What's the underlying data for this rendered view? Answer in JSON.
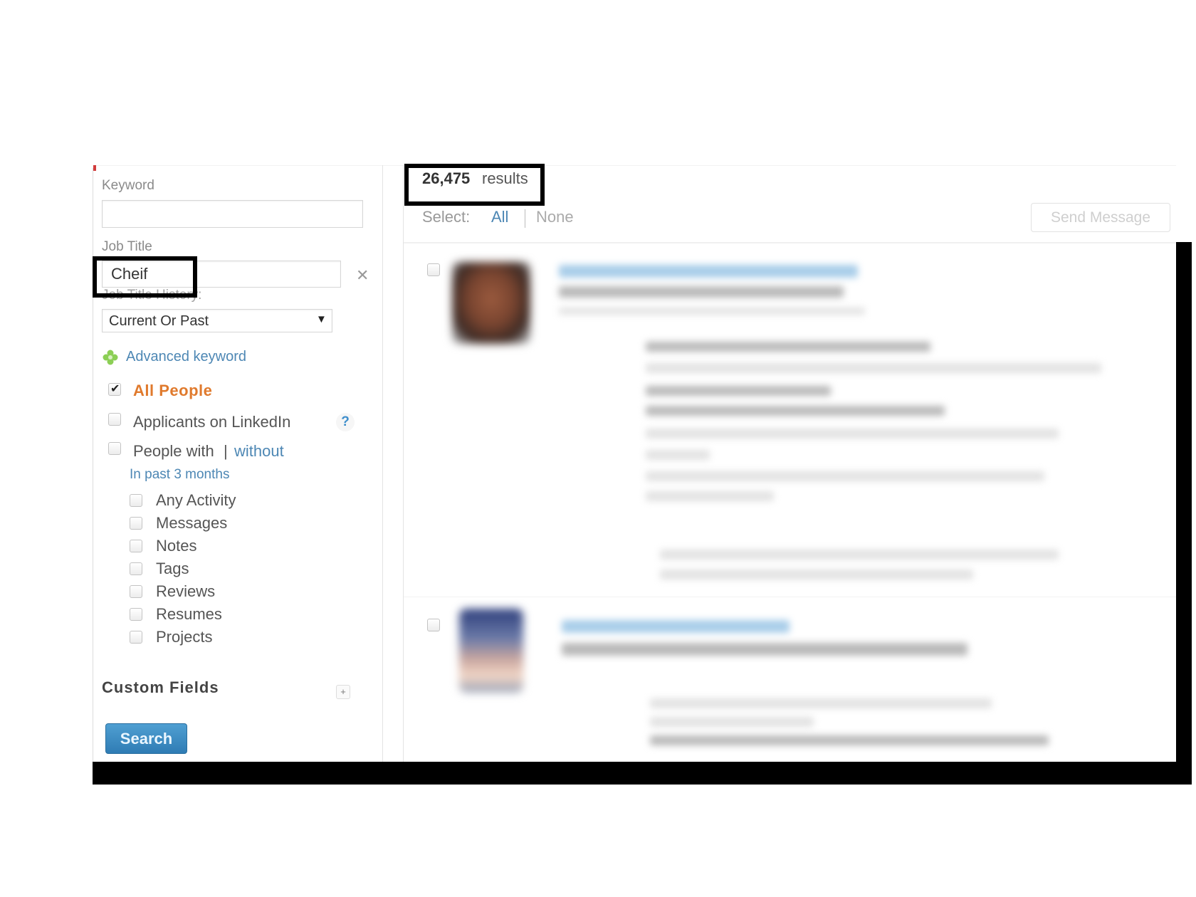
{
  "sidebar": {
    "keyword": {
      "label": "Keyword",
      "value": ""
    },
    "job_title": {
      "label": "Job Title",
      "value": "Cheif"
    },
    "job_title_history": {
      "label": "Job Title History:",
      "selected": "Current Or Past"
    },
    "advanced_keyword": "Advanced keyword",
    "filters": {
      "all_people": {
        "label": "All People",
        "checked": true
      },
      "applicants": {
        "label": "Applicants on LinkedIn",
        "checked": false,
        "help": "?"
      },
      "people_with": {
        "label_with": "People with",
        "separator": "|",
        "label_without": "without",
        "checked": false
      },
      "timeframe": "In past 3 months"
    },
    "activities": [
      {
        "label": "Any Activity",
        "checked": false
      },
      {
        "label": "Messages",
        "checked": false
      },
      {
        "label": "Notes",
        "checked": false
      },
      {
        "label": "Tags",
        "checked": false
      },
      {
        "label": "Reviews",
        "checked": false
      },
      {
        "label": "Resumes",
        "checked": false
      },
      {
        "label": "Projects",
        "checked": false
      }
    ],
    "custom_fields": {
      "title": "Custom Fields",
      "add_icon": "+"
    },
    "search_label": "Search",
    "clear_icon": "✕"
  },
  "main": {
    "results_count": "26,475",
    "results_word": "results",
    "select": {
      "label": "Select:",
      "all": "All",
      "none": "None"
    },
    "send_message_label": "Send Message",
    "results": [
      {
        "name": "(blurred)",
        "checked": false
      },
      {
        "name": "(blurred)",
        "checked": false
      }
    ]
  },
  "colors": {
    "accent_link": "#4d87b4",
    "all_people_orange": "#e07a2d",
    "search_button": "#2f7cb4",
    "highlight_box": "#000000"
  }
}
